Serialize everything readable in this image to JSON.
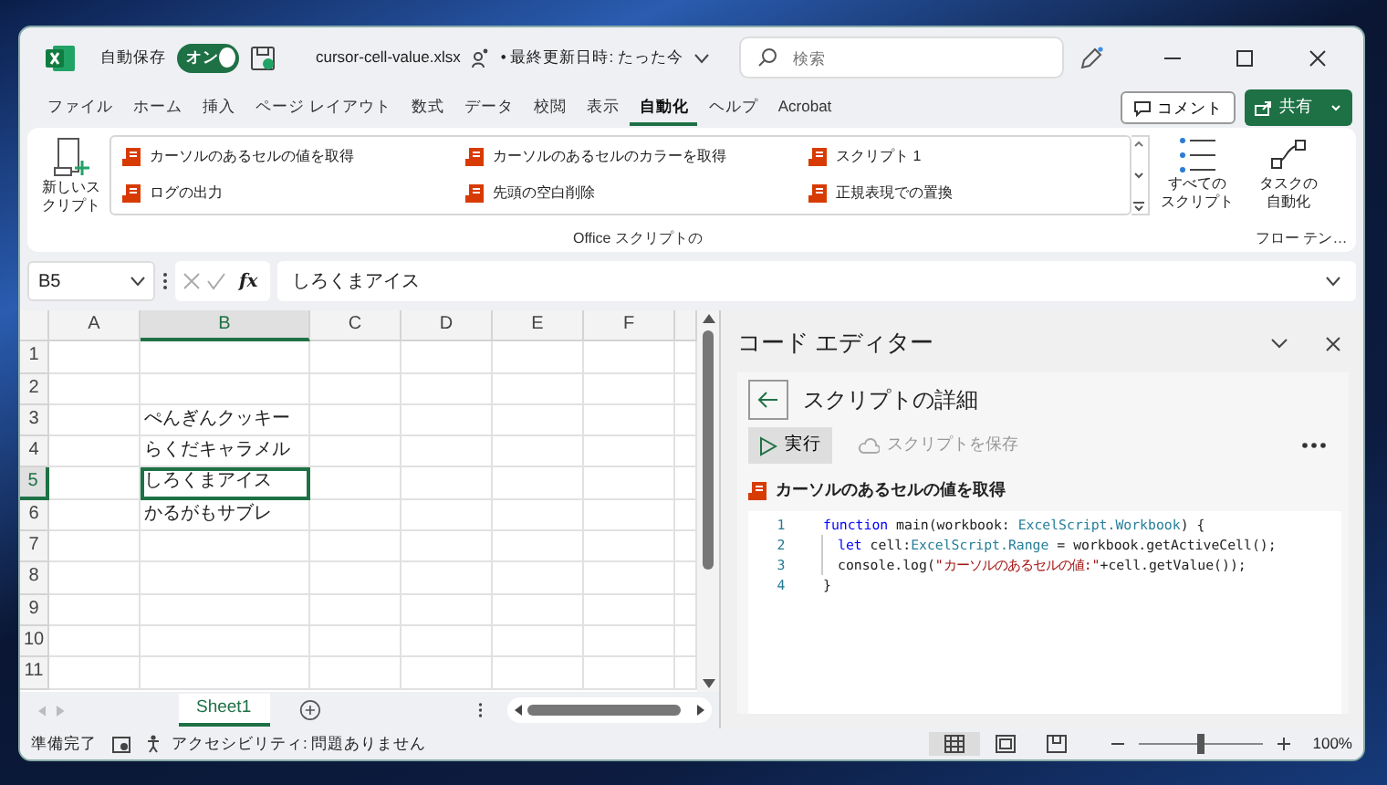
{
  "title_bar": {
    "autosave_label": "自動保存",
    "autosave": {
      "on": true,
      "label": "オン"
    },
    "filename": "cursor-cell-value.xlsx",
    "saved_status": "• 最終更新日時: たった今",
    "search": {
      "placeholder": "検索"
    }
  },
  "menu_tabs": [
    {
      "label": "ファイル",
      "selected": false
    },
    {
      "label": "ホーム",
      "selected": false
    },
    {
      "label": "挿入",
      "selected": false
    },
    {
      "label": "ページ レイアウト",
      "selected": false
    },
    {
      "label": "数式",
      "selected": false
    },
    {
      "label": "データ",
      "selected": false
    },
    {
      "label": "校閲",
      "selected": false
    },
    {
      "label": "表示",
      "selected": false
    },
    {
      "label": "自動化",
      "selected": true
    },
    {
      "label": "ヘルプ",
      "selected": false
    },
    {
      "label": "Acrobat",
      "selected": false
    }
  ],
  "comment_button": "コメント",
  "share_button": "共有",
  "ribbon": {
    "new_script": [
      "新しいス",
      "クリプト"
    ],
    "scripts": [
      "カーソルのあるセルの値を取得",
      "カーソルのあるセルのカラーを取得",
      "スクリプト 1",
      "ログの出力",
      "先頭の空白削除",
      "正規表現での置換"
    ],
    "all_scripts": [
      "すべての",
      "スクリプト"
    ],
    "group_label": "Office スクリプトの",
    "automate_task": [
      "タスクの",
      "自動化"
    ],
    "flow_group_label": "フロー テン…"
  },
  "formula_bar": {
    "name_box": "B5",
    "fx": "fx",
    "value": "しろくまアイス"
  },
  "grid": {
    "columns": [
      {
        "label": "A",
        "selected": false
      },
      {
        "label": "B",
        "selected": true
      },
      {
        "label": "C",
        "selected": false
      },
      {
        "label": "D",
        "selected": false
      },
      {
        "label": "E",
        "selected": false
      },
      {
        "label": "F",
        "selected": false
      }
    ],
    "rows": [
      {
        "label": "1",
        "selected": false
      },
      {
        "label": "2",
        "selected": false
      },
      {
        "label": "3",
        "selected": false,
        "B": "ぺんぎんクッキー"
      },
      {
        "label": "4",
        "selected": false,
        "B": "らくだキャラメル"
      },
      {
        "label": "5",
        "selected": true,
        "B": "しろくまアイス"
      },
      {
        "label": "6",
        "selected": false,
        "B": "かるがもサブレ"
      },
      {
        "label": "7",
        "selected": false
      },
      {
        "label": "8",
        "selected": false
      },
      {
        "label": "9",
        "selected": false
      },
      {
        "label": "10",
        "selected": false
      },
      {
        "label": "11",
        "selected": false
      }
    ]
  },
  "sheet_tabs": [
    {
      "label": "Sheet1",
      "selected": true
    }
  ],
  "code_editor": {
    "title": "コード エディター",
    "heading": "スクリプトの詳細",
    "run_button": "実行",
    "save_button": {
      "label": "スクリプトを保存",
      "disabled": true
    },
    "script_name": "カーソルのあるセルの値を取得",
    "lines": [
      {
        "number": "1",
        "indented": false,
        "tokens": [
          {
            "kind": "keyword",
            "text": "function"
          },
          {
            "kind": "plain",
            "text": " main(workbook: "
          },
          {
            "kind": "type",
            "text": "ExcelScript.Workbook"
          },
          {
            "kind": "plain",
            "text": ") {"
          }
        ]
      },
      {
        "number": "2",
        "indented": true,
        "tokens": [
          {
            "kind": "keyword",
            "text": "let"
          },
          {
            "kind": "plain",
            "text": " cell:"
          },
          {
            "kind": "type",
            "text": "ExcelScript.Range"
          },
          {
            "kind": "plain",
            "text": " = workbook.getActiveCell();"
          }
        ]
      },
      {
        "number": "3",
        "indented": true,
        "tokens": [
          {
            "kind": "plain",
            "text": "console.log("
          },
          {
            "kind": "string",
            "text": "\"カーソルのあるセルの値:\""
          },
          {
            "kind": "plain",
            "text": "+cell.getValue());"
          }
        ]
      },
      {
        "number": "4",
        "indented": false,
        "tokens": [
          {
            "kind": "plain",
            "text": "}"
          }
        ]
      }
    ]
  },
  "status_bar": {
    "ready": "準備完了",
    "accessibility": "アクセシビリティ: 問題ありません",
    "views": [
      {
        "kind": "normal",
        "selected": true
      },
      {
        "kind": "page_layout",
        "selected": false
      },
      {
        "kind": "page_break",
        "selected": false
      }
    ],
    "zoom": {
      "level": 0.5,
      "label": "100%"
    }
  }
}
